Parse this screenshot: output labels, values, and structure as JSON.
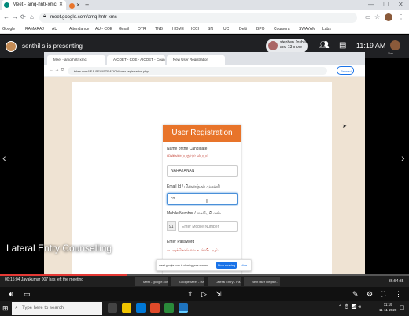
{
  "outer_browser": {
    "tabs": [
      {
        "label": "Meet - amq-hntr-xmc",
        "active": true
      },
      {
        "label": "",
        "active": false
      }
    ],
    "url": "meet.google.com/amq-hntr-xmc",
    "bookmarks": [
      "Google",
      "RAMARAJ",
      "AU",
      "Attendance",
      "AU - COE",
      "Gmail",
      "OTR",
      "TNB",
      "HOME",
      "ICCI",
      "SN",
      "UC",
      "Delti",
      "BPO",
      "Coursera",
      "SWAYAM",
      "Labs"
    ]
  },
  "meet": {
    "presenter_text": "senthil s is presenting",
    "participants_pill": "stephen Joshua and 13 more",
    "time": "11:19 AM",
    "you_label": "You",
    "caption": "Lateral Entry Counselling",
    "joined_notice": "Jayakumar 007 has left the meeting",
    "timestamp_left": "00:15:04",
    "timestamp_right": "36:54:35",
    "progress": 0.31
  },
  "shared_screen": {
    "tabs": [
      "Meet - amq-hntr-xmc",
      "AICOET - COE - AICOET - Coun",
      "New User Registration"
    ],
    "url": "tnlea.com/LEA-REGISTRATION/user-registration.php",
    "paused_label": "Paused",
    "form": {
      "title": "User Registration",
      "name_label": "Name of the Candidate",
      "name_label_ta": "விண்ணப்பதாரர் பெயர்",
      "name_value": "NARAYANAN",
      "email_label": "Email Id / மின்னஞ்சல் முகவரி",
      "email_value": "co",
      "mobile_label": "Mobile Number / கைபேசி எண்",
      "country_code": "91",
      "mobile_placeholder": "Enter Mobile Number",
      "password_label": "Enter Password",
      "password_label_ta": "கடவுச்சொல்லை உள்ளிடவும்"
    },
    "share_bar": {
      "text": "meet.google.com is sharing your screen.",
      "stop_label": "Stop sharing",
      "hide_label": "Hide"
    }
  },
  "taskbar": {
    "search_placeholder": "Type here to search",
    "items": [
      "Meet - google.com...",
      "Google Meet - Ha...",
      "Lateral Entry - Ra...",
      "Next user Registr..."
    ],
    "clock_time": "11:19",
    "clock_date": "11-11-2020"
  }
}
